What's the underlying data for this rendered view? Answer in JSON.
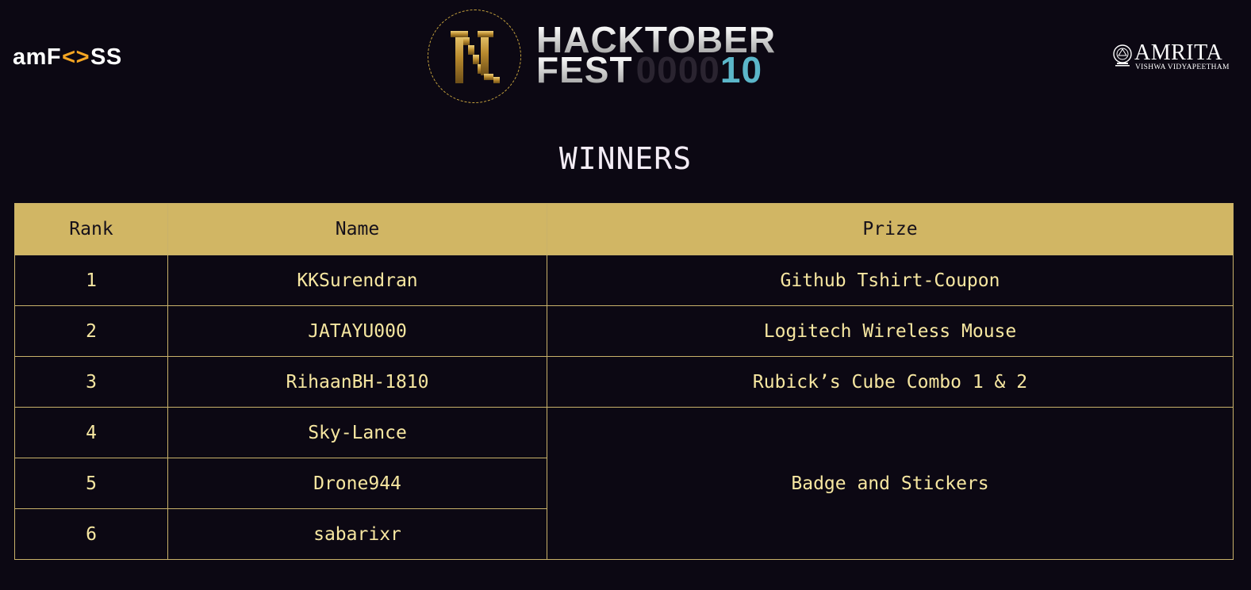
{
  "header": {
    "left_logo": {
      "part1": "amF",
      "brackets": "<>",
      "part2": "SS"
    },
    "center_logo": {
      "line1": "HACKTOBER",
      "line2_main": "FEST",
      "line2_zeros": "0000",
      "line2_number": "10"
    },
    "right_logo": {
      "name": "AMRITA",
      "subtitle": "VISHWA VIDYAPEETHAM"
    }
  },
  "page": {
    "heading": "WINNERS"
  },
  "table": {
    "columns": [
      "Rank",
      "Name",
      "Prize"
    ],
    "rows": [
      {
        "rank": "1",
        "name": "KKSurendran",
        "prize": "Github Tshirt-Coupon"
      },
      {
        "rank": "2",
        "name": "JATAYU000",
        "prize": "Logitech Wireless Mouse"
      },
      {
        "rank": "3",
        "name": "RihaanBH-1810",
        "prize": "Rubick’s Cube Combo 1 & 2"
      },
      {
        "rank": "4",
        "name": "Sky-Lance",
        "prize": "Badge and Stickers"
      },
      {
        "rank": "5",
        "name": "Drone944"
      },
      {
        "rank": "6",
        "name": "sabarixr"
      }
    ]
  },
  "colors": {
    "background": "#0c0813",
    "header_row": "#d1b664",
    "cell_text": "#f7e7a1",
    "border": "#c9b26a",
    "accent_orange": "#f5a623",
    "accent_teal": "#5bb6c9"
  }
}
